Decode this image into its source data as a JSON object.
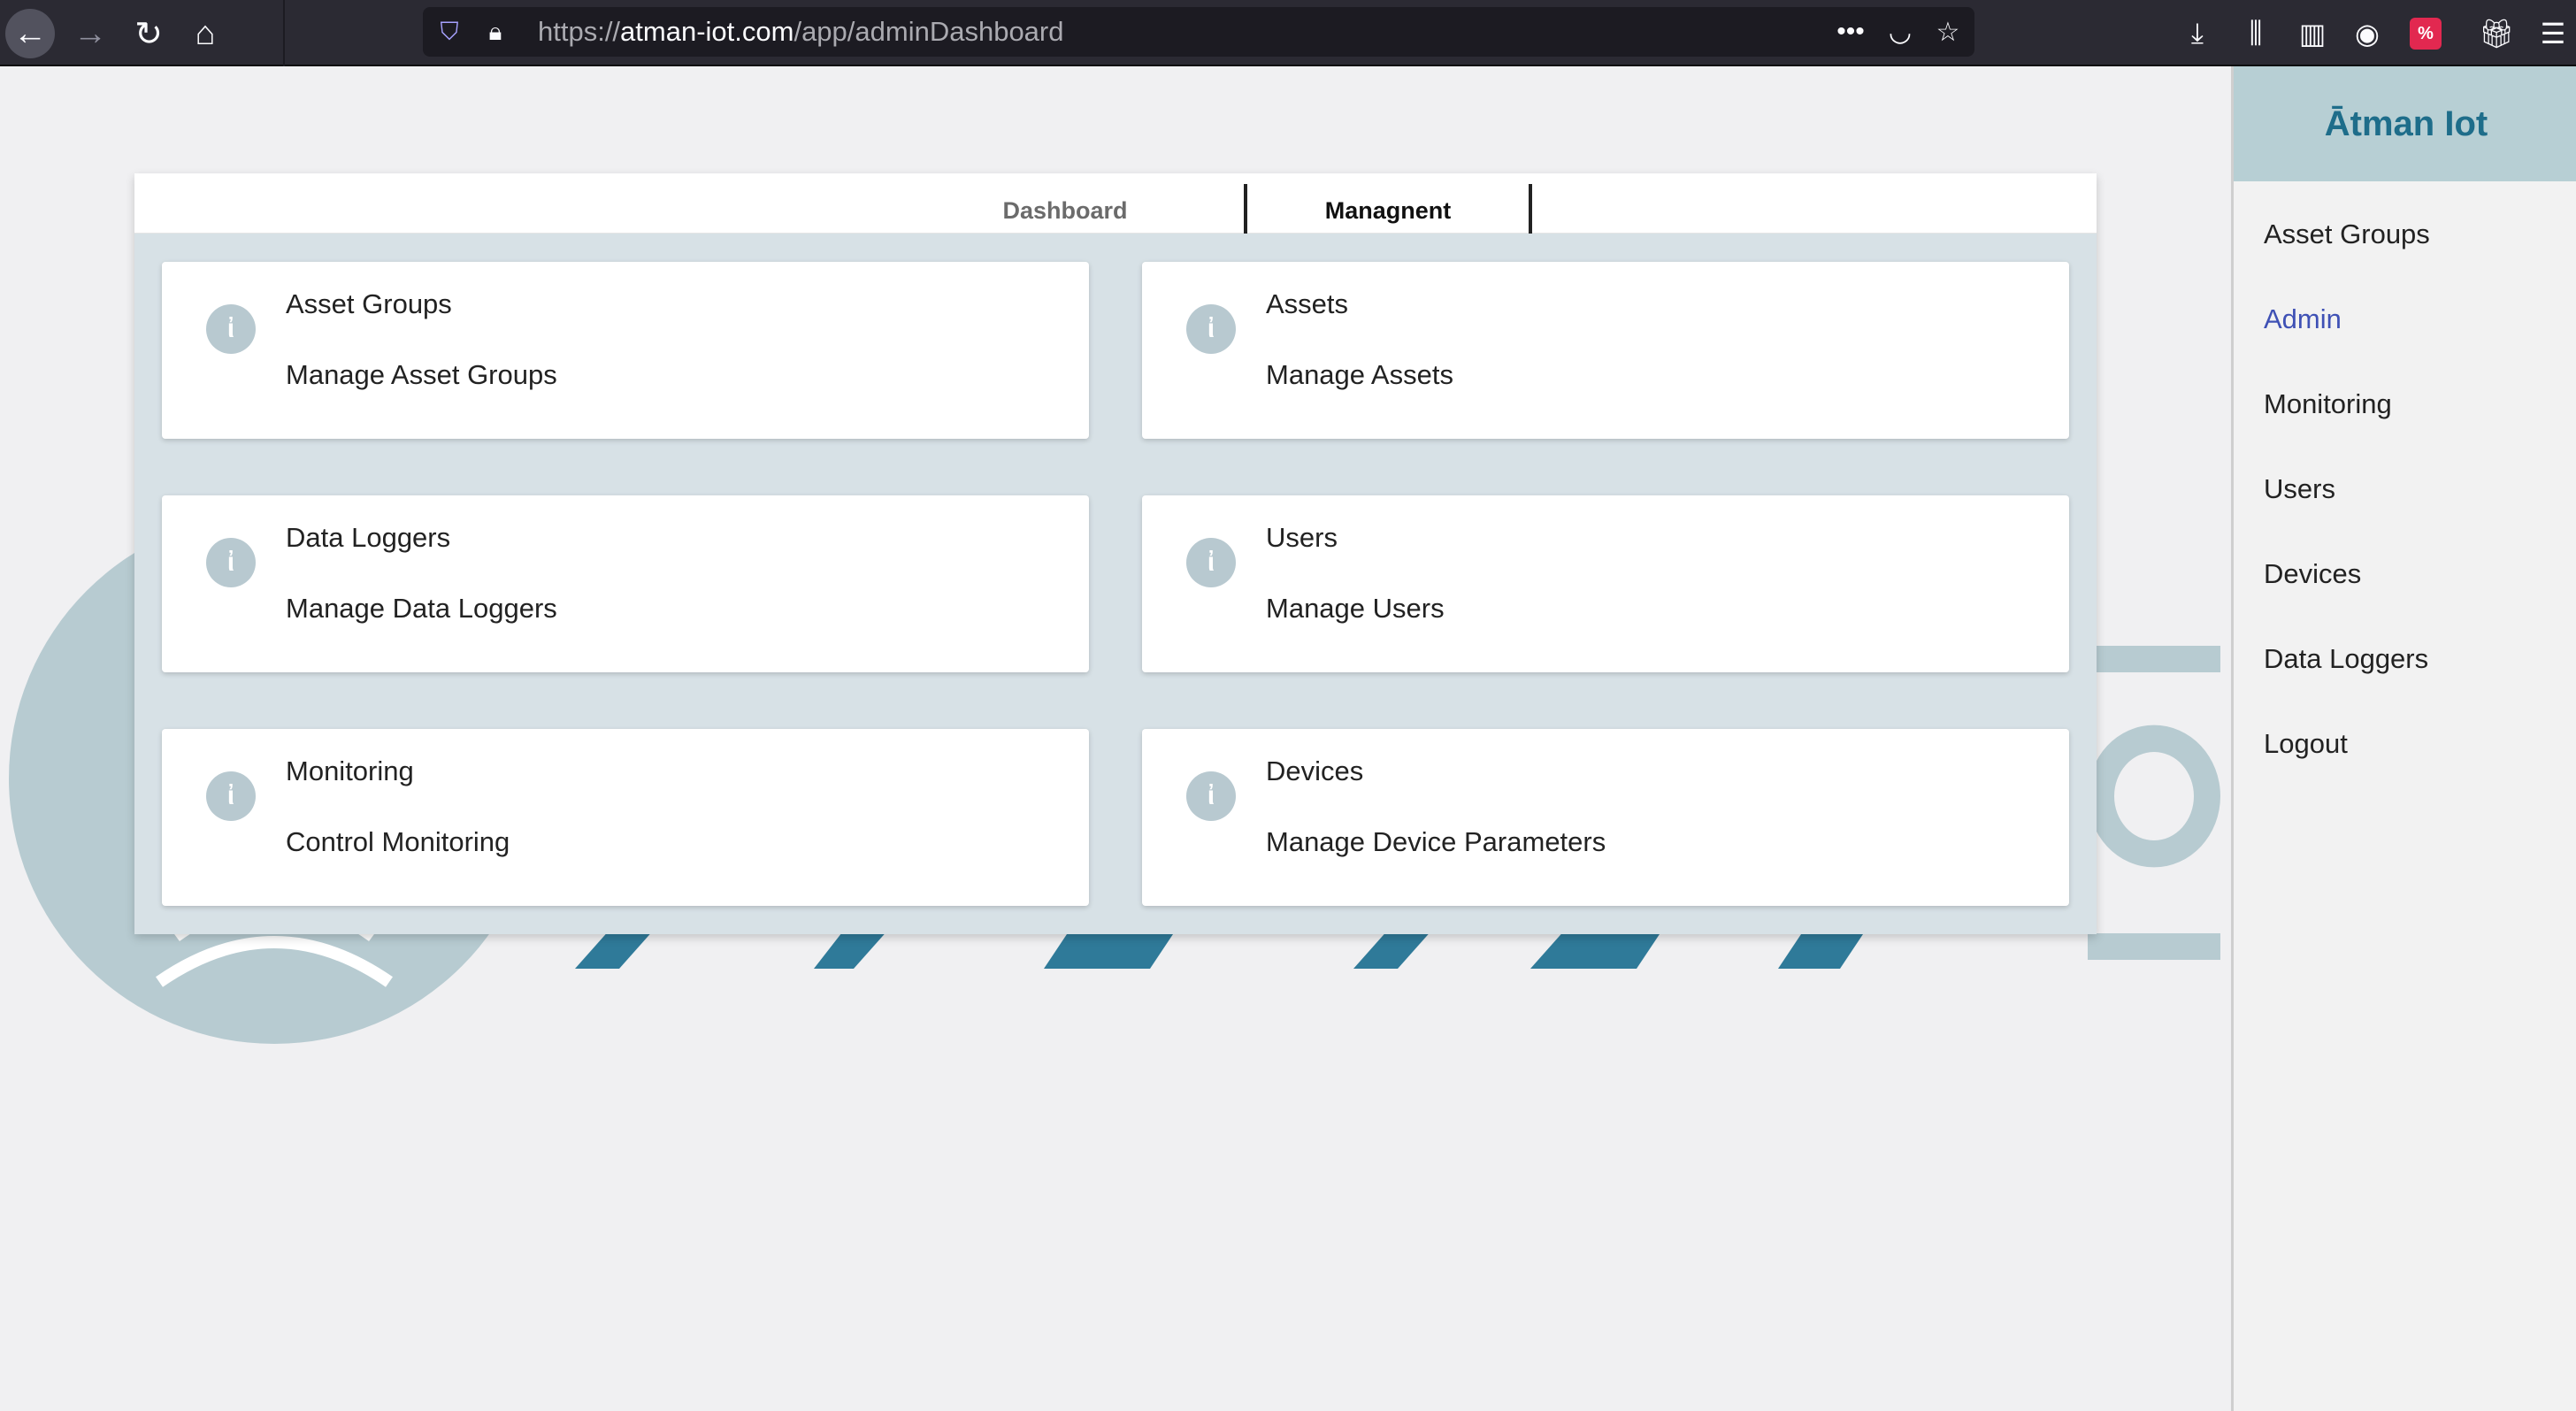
{
  "browser": {
    "url_scheme": "https://",
    "url_host": "atman-iot.com",
    "url_path": "/app/adminDashboard",
    "badge_text": "%"
  },
  "tabs": [
    {
      "label": "Dashboard"
    },
    {
      "label": "Managnent"
    }
  ],
  "cards": [
    {
      "title": "Asset Groups",
      "subtitle": "Manage Asset Groups"
    },
    {
      "title": "Assets",
      "subtitle": "Manage Assets"
    },
    {
      "title": "Data Loggers",
      "subtitle": "Manage Data Loggers"
    },
    {
      "title": "Users",
      "subtitle": "Manage Users"
    },
    {
      "title": "Monitoring",
      "subtitle": "Control Monitoring"
    },
    {
      "title": "Devices",
      "subtitle": "Manage Device Parameters"
    }
  ],
  "sidebar": {
    "title": "Ātman Iot",
    "items": [
      {
        "label": "Asset Groups"
      },
      {
        "label": "Admin"
      },
      {
        "label": "Monitoring"
      },
      {
        "label": "Users"
      },
      {
        "label": "Devices"
      },
      {
        "label": "Data Loggers"
      },
      {
        "label": "Logout"
      }
    ]
  },
  "colors": {
    "accent": "#3f51b5",
    "brand": "#1e6d8a",
    "sidebar_header": "#b7cfd4",
    "panel_bg": "#d7e1e6"
  }
}
